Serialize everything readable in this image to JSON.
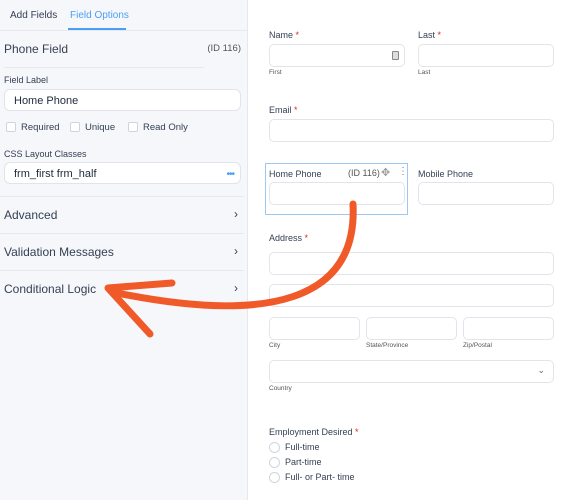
{
  "left_panel": {
    "tabs": [
      {
        "label": "Add Fields"
      },
      {
        "label": "Field Options",
        "active": true
      }
    ],
    "field_title": "Phone Field",
    "field_id": "(ID 116)",
    "field_label_caption": "Field Label",
    "field_label_value": "Home Phone",
    "checkboxes": [
      {
        "label": "Required",
        "checked": false
      },
      {
        "label": "Unique",
        "checked": false
      },
      {
        "label": "Read Only",
        "checked": false
      }
    ],
    "css_caption": "CSS Layout Classes",
    "css_value": "frm_first frm_half",
    "css_more_icon": "more-dots-icon",
    "sections": [
      {
        "label": "Advanced"
      },
      {
        "label": "Validation Messages"
      },
      {
        "label": "Conditional Logic"
      }
    ],
    "chevron": "›"
  },
  "form": {
    "name_label": "Name",
    "last_label": "Last",
    "required_mark": "*",
    "first_sub": "First",
    "last_sub": "Last",
    "email_label": "Email",
    "home_phone_label": "Home Phone",
    "home_phone_id": "(ID 116)",
    "mobile_phone_label": "Mobile Phone",
    "address_label": "Address",
    "city_sub": "City",
    "state_sub": "State/Province",
    "zip_sub": "Zip/Postal",
    "country_sub": "Country",
    "employment_label": "Employment Desired",
    "employment_options": [
      {
        "label": "Full-time"
      },
      {
        "label": "Part-time"
      },
      {
        "label": "Full- or Part- time"
      }
    ]
  },
  "colors": {
    "accent": "#4a9ff5",
    "arrow": "#f05a28",
    "required": "#d92d20"
  }
}
